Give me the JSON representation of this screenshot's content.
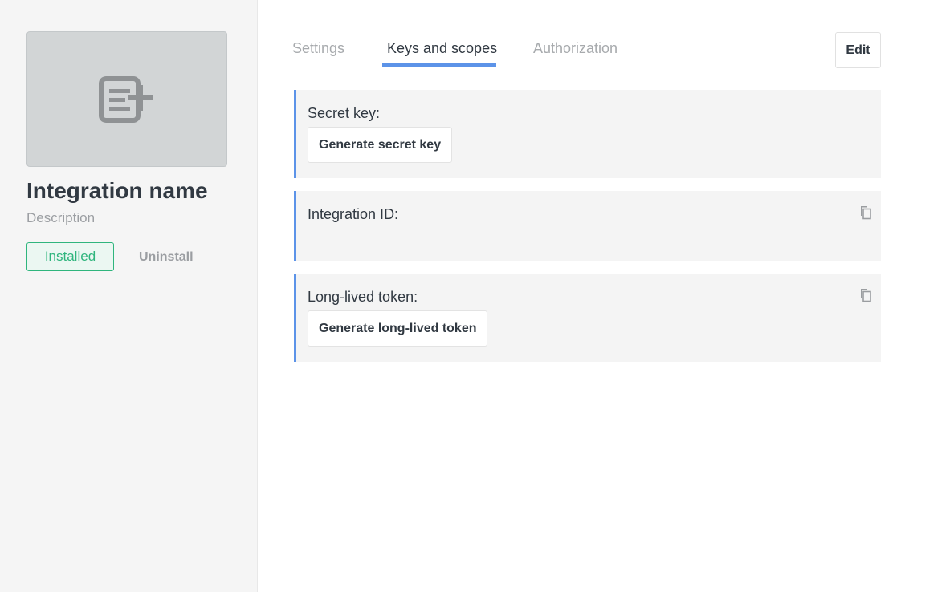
{
  "sidebar": {
    "logo_icon": "add-list-icon",
    "name": "Integration name",
    "description": "Description",
    "installed_label": "Installed",
    "uninstall_label": "Uninstall"
  },
  "tabs": [
    {
      "label": "Settings",
      "active": false
    },
    {
      "label": "Keys and scopes",
      "active": true
    },
    {
      "label": "Authorization",
      "active": false
    }
  ],
  "edit_label": "Edit",
  "cards": {
    "secret": {
      "label": "Secret key:",
      "button": "Generate secret key"
    },
    "integration_id": {
      "label": "Integration ID:",
      "value": "",
      "copy_icon": "copy-icon"
    },
    "token": {
      "label": "Long-lived token:",
      "button": "Generate long-lived token",
      "copy_icon": "copy-icon"
    }
  },
  "colors": {
    "accent": "#5c93e8",
    "installed": "#2fb57d",
    "sidebar_bg": "#f5f5f5",
    "card_bg": "#f4f4f4"
  }
}
